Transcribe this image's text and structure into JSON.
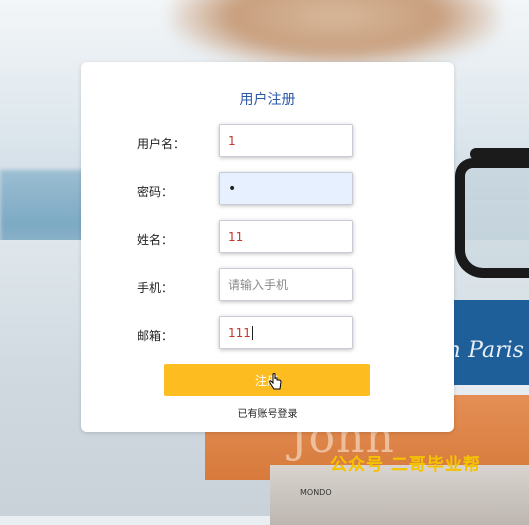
{
  "form": {
    "title": "用户注册",
    "fields": [
      {
        "label": "用户名：",
        "value": "1",
        "placeholder": ""
      },
      {
        "label": "密码：",
        "value": "•",
        "placeholder": ""
      },
      {
        "label": "姓名：",
        "value": "11",
        "placeholder": ""
      },
      {
        "label": "手机：",
        "value": "",
        "placeholder": "请输入手机"
      },
      {
        "label": "邮箱：",
        "value": "111",
        "placeholder": ""
      }
    ],
    "submit_label": "注册",
    "login_link": "已有账号登录"
  },
  "background": {
    "book_blue_text": "h Paris",
    "book_orange_text": "John Grisham",
    "book_bottom_label": "MONDO"
  },
  "watermark": "公众号 二哥毕业帮",
  "colors": {
    "title": "#2c59a8",
    "button": "#fdbd20",
    "watermark": "#f4c300",
    "value_text": "#c0392b"
  }
}
